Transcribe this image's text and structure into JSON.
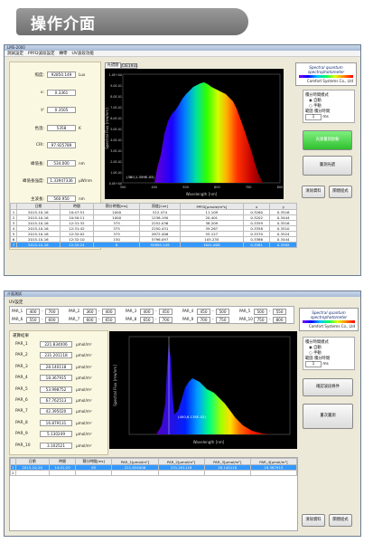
{
  "header": {
    "title": "操作介面"
  },
  "win1": {
    "title": "LMS-2000",
    "menu": [
      "測試設定",
      "PPFD波段設定",
      "轉零",
      "UV波段功能"
    ],
    "readings": [
      {
        "label": "照度:",
        "value": "92850.149",
        "unit": "Lux"
      },
      {
        "label": "x:",
        "value": "0.3361",
        "unit": ""
      },
      {
        "label": "y:",
        "value": "0.3505",
        "unit": ""
      },
      {
        "label": "色溫:",
        "value": "5358",
        "unit": "K"
      },
      {
        "label": "CRI:",
        "value": "97.925789",
        "unit": ""
      },
      {
        "label": "峰值長:",
        "value": "534.000",
        "unit": "nm"
      },
      {
        "label": "峰值長強度:",
        "value": "1.33947336",
        "unit": "µW/nm"
      },
      {
        "label": "主波長:",
        "value": "560.950",
        "unit": "nm"
      },
      {
        "label": "中心波長:",
        "value": "595.000",
        "unit": "nm"
      },
      {
        "label": "PPFD:",
        "value": "1641.608",
        "unit": "µmole/m²/s"
      }
    ],
    "tabs": [
      "光譜圖",
      "CIE1931"
    ],
    "chart": {
      "ylabel": "Spectral Flux [mw/nm]",
      "xlabel": "Wavelength [nm]",
      "yticks": [
        "1.0E+00",
        "9.0E-01",
        "8.0E-01",
        "7.0E-01",
        "6.0E-01",
        "5.0E-01",
        "4.0E-01",
        "3.0E-01",
        "2.0E-01",
        "1.0E-01",
        "0.0E+00"
      ],
      "xticks": [
        "300",
        "400",
        "500",
        "600",
        "700",
        "800"
      ],
      "annotation": "(380,1.359E-03)"
    },
    "brand": {
      "title": "Spectral quantum spectrophotometer",
      "sub": "Comfort Systems Co., Ltd"
    },
    "integration": {
      "title": "積分時間模式",
      "auto": "自動",
      "manual": "手動",
      "range_label": "範圍",
      "time_label": "積分時間",
      "time_value": "1",
      "ms_label": "ms"
    },
    "buttons": {
      "green": "光源量測啟動",
      "measure": "量測光譜",
      "clear": "清除資料",
      "close": "關閉程式"
    },
    "table": {
      "headers": [
        "",
        "日期",
        "時間",
        "積分時間[ms]",
        "照度[Lux]",
        "PPFD[µmole/m²s]",
        "x",
        "y"
      ],
      "rows": [
        [
          "1",
          "2015-10-16",
          "10:47:51",
          "1000",
          "512.474",
          "11.109",
          "0.3260",
          "0.3516"
        ],
        [
          "2",
          "2015-10-16",
          "10:50:11",
          "1000",
          "1236.190",
          "20.401",
          "0.3202",
          "0.3444"
        ],
        [
          "3",
          "2015-10-16",
          "12:31:32",
          "375",
          "2252.036",
          "38.209",
          "0.3359",
          "0.3516"
        ],
        [
          "4",
          "2015-10-16",
          "12:31:42",
          "375",
          "2250.431",
          "39.267",
          "0.3358",
          "0.3510"
        ],
        [
          "5",
          "2015-10-16",
          "12:32:02",
          "375",
          "2872.406",
          "55.127",
          "0.3370",
          "0.3524"
        ],
        [
          "6",
          "2015-10-16",
          "12:32:10",
          "150",
          "5796.097",
          "105.235",
          "0.3386",
          "0.3444"
        ],
        [
          "7",
          "2015-10-16",
          "12:32:24",
          "8",
          "92850.149",
          "1641.608",
          "0.3361",
          "0.3505"
        ]
      ]
    }
  },
  "win2": {
    "title": "介面測試",
    "uv_section": "UV設定",
    "par_rows": [
      [
        {
          "name": "PAR_1",
          "from": "400",
          "to": "700"
        },
        {
          "name": "PAR_2",
          "from": "360",
          "to": "400"
        },
        {
          "name": "PAR_3",
          "from": "400",
          "to": "450"
        },
        {
          "name": "PAR_4",
          "from": "450",
          "to": "500"
        },
        {
          "name": "PAR_5",
          "from": "500",
          "to": "550"
        }
      ],
      [
        {
          "name": "PAR_6",
          "from": "550",
          "to": "600"
        },
        {
          "name": "PAR_7",
          "from": "600",
          "to": "650"
        },
        {
          "name": "PAR_8",
          "from": "650",
          "to": "700"
        },
        {
          "name": "PAR_9",
          "from": "700",
          "to": "750"
        },
        {
          "name": "PAR_10",
          "from": "750",
          "to": "800"
        }
      ]
    ],
    "results_title": "運算結果",
    "results": [
      {
        "label": "PAR_1",
        "value": "221.834006",
        "unit": "µmol/m²"
      },
      {
        "label": "PAR_2",
        "value": "231.201118",
        "unit": "µmol/m²"
      },
      {
        "label": "PAR_3",
        "value": "28.140118",
        "unit": "µmol/m²"
      },
      {
        "label": "PAR_4",
        "value": "18.367915",
        "unit": "µmol/m²"
      },
      {
        "label": "PAR_5",
        "value": "53.998752",
        "unit": "µmol/m²"
      },
      {
        "label": "PAR_6",
        "value": "67.762513",
        "unit": "µmol/m²"
      },
      {
        "label": "PAR_7",
        "value": "42.395020",
        "unit": "µmol/m²"
      },
      {
        "label": "PAR_8",
        "value": "16.879131",
        "unit": "µmol/m²"
      },
      {
        "label": "PAR_9",
        "value": "5.130249",
        "unit": "µmol/m²"
      },
      {
        "label": "PAR_10",
        "value": "3.102521",
        "unit": "µmol/m²"
      }
    ],
    "chart": {
      "ylabel": "Spectral Flux [mw/nm]",
      "xlabel": "Wavelength [nm]",
      "annotation": "(400,6.138E-02)"
    },
    "brand": {
      "title": "Spectral quantum spectrophotometer",
      "sub": "Comfort Systems Co., Ltd"
    },
    "integration": {
      "title": "積分時間模式",
      "auto": "自動",
      "manual": "手動",
      "range_label": "範圍",
      "time_label": "積分時間",
      "time_value": "1",
      "ms_label": "ms"
    },
    "buttons": {
      "par": "確認波段條件",
      "measure": "量次量測",
      "clear": "清除資料",
      "close": "關閉程式"
    },
    "table": {
      "headers": [
        "",
        "日期",
        "時間",
        "積分時間[ms]",
        "PAR_1[µmol/m²]",
        "PAR_2[µmol/m²]",
        "PAR_3[µmol/m²]",
        "PAR_4[µmol/m²]"
      ],
      "rows": [
        [
          "1",
          "2015-10-20",
          "14:41:29",
          "65",
          "221.834006",
          "231.201118",
          "28.140118",
          "18.367915"
        ],
        [
          "2",
          "",
          "",
          "",
          "",
          "",
          "",
          ""
        ]
      ]
    }
  }
}
